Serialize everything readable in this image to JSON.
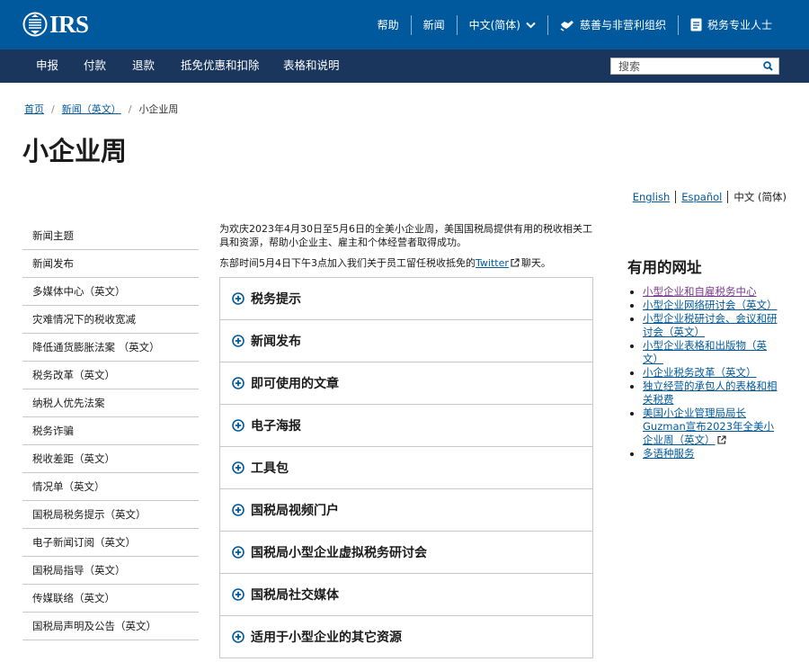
{
  "header": {
    "logo_text": "IRS",
    "links": [
      {
        "label": "帮助",
        "icon": ""
      },
      {
        "label": "新闻",
        "icon": ""
      },
      {
        "label": "中文(简体)",
        "icon": "chevron-down-icon"
      },
      {
        "label": "慈善与非营利组织",
        "icon": "handshake-icon"
      },
      {
        "label": "税务专业人士",
        "icon": "document-icon"
      }
    ]
  },
  "nav": {
    "items": [
      "申报",
      "付款",
      "退款",
      "抵免优惠和扣除",
      "表格和说明"
    ],
    "search_placeholder": "搜索"
  },
  "breadcrumb": {
    "home": "首页",
    "news": "新闻（英文）",
    "current": "小企业周"
  },
  "page_title": "小企业周",
  "languages": {
    "english": "English",
    "spanish": "Español",
    "current": "中文 (简体)"
  },
  "sidebar": {
    "items": [
      "新闻主题",
      "新闻发布",
      "多媒体中心（英文）",
      "灾难情况下的税收宽减",
      "降低通货膨胀法案 （英文）",
      "税务改革（英文）",
      "纳税人优先法案",
      "税务诈骗",
      "税收差距（英文）",
      "情况单（英文）",
      "国税局税务提示（英文）",
      "电子新闻订阅（英文）",
      "国税局指导（英文）",
      "传媒联络（英文）",
      "国税局声明及公告（英文）"
    ]
  },
  "content": {
    "intro": "为欢庆2023年4月30日至5月6日的全美小企业周，美国国税局提供有用的税收相关工具和资源，帮助小企业主、雇主和个体经营者取得成功。",
    "chat_prefix": "东部时间5月4日下午3点加入我们关于员工留任税收抵免的",
    "chat_link": "Twitter",
    "chat_suffix": "聊天。",
    "accordion": [
      "税务提示",
      "新闻发布",
      "即可使用的文章",
      "电子海报",
      "工具包",
      "国税局视频门户",
      "国税局小型企业虚拟税务研讨会",
      "国税局社交媒体",
      "适用于小型企业的其它资源"
    ]
  },
  "useful": {
    "title": "有用的网址",
    "links": [
      "小型企业和自雇税务中心",
      "小型企业网络研讨会（英文）",
      "小型企业税研讨会、会议和研讨会（英文）",
      "小型企业表格和出版物（英文）",
      "小企业税务改革（英文）",
      "独立经营的承包人的表格和相关税费",
      "美国小企业管理局局长Guzman宣布2023年全美小企业周（英文）",
      "多语种服务"
    ]
  },
  "colors": {
    "header_blue": "#00599c",
    "nav_navy": "#1b365d",
    "link_blue": "#00599c",
    "visited_purple": "#7a3a8c"
  }
}
